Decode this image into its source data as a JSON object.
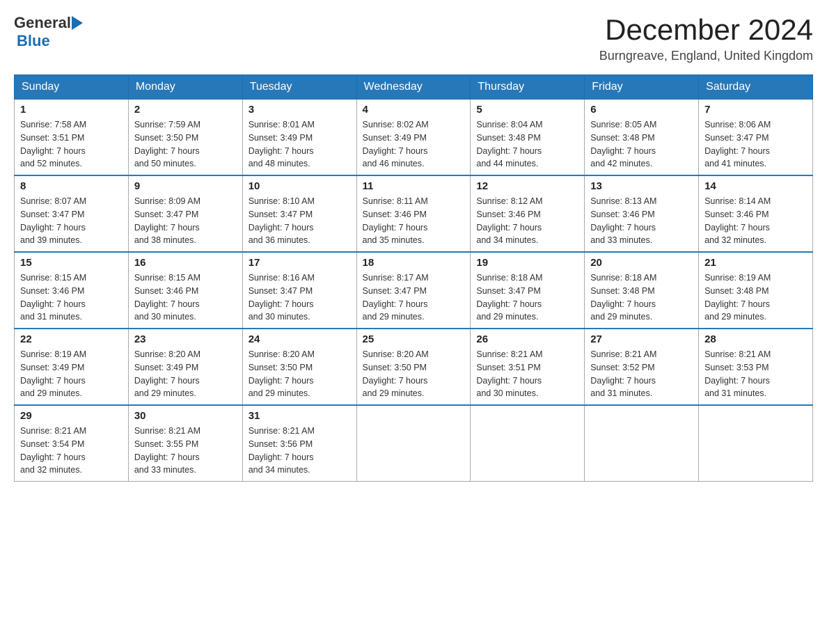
{
  "header": {
    "month_year": "December 2024",
    "location": "Burngreave, England, United Kingdom"
  },
  "logo": {
    "general": "General",
    "blue": "Blue"
  },
  "days_of_week": [
    "Sunday",
    "Monday",
    "Tuesday",
    "Wednesday",
    "Thursday",
    "Friday",
    "Saturday"
  ],
  "weeks": [
    [
      {
        "day": "1",
        "info": "Sunrise: 7:58 AM\nSunset: 3:51 PM\nDaylight: 7 hours\nand 52 minutes."
      },
      {
        "day": "2",
        "info": "Sunrise: 7:59 AM\nSunset: 3:50 PM\nDaylight: 7 hours\nand 50 minutes."
      },
      {
        "day": "3",
        "info": "Sunrise: 8:01 AM\nSunset: 3:49 PM\nDaylight: 7 hours\nand 48 minutes."
      },
      {
        "day": "4",
        "info": "Sunrise: 8:02 AM\nSunset: 3:49 PM\nDaylight: 7 hours\nand 46 minutes."
      },
      {
        "day": "5",
        "info": "Sunrise: 8:04 AM\nSunset: 3:48 PM\nDaylight: 7 hours\nand 44 minutes."
      },
      {
        "day": "6",
        "info": "Sunrise: 8:05 AM\nSunset: 3:48 PM\nDaylight: 7 hours\nand 42 minutes."
      },
      {
        "day": "7",
        "info": "Sunrise: 8:06 AM\nSunset: 3:47 PM\nDaylight: 7 hours\nand 41 minutes."
      }
    ],
    [
      {
        "day": "8",
        "info": "Sunrise: 8:07 AM\nSunset: 3:47 PM\nDaylight: 7 hours\nand 39 minutes."
      },
      {
        "day": "9",
        "info": "Sunrise: 8:09 AM\nSunset: 3:47 PM\nDaylight: 7 hours\nand 38 minutes."
      },
      {
        "day": "10",
        "info": "Sunrise: 8:10 AM\nSunset: 3:47 PM\nDaylight: 7 hours\nand 36 minutes."
      },
      {
        "day": "11",
        "info": "Sunrise: 8:11 AM\nSunset: 3:46 PM\nDaylight: 7 hours\nand 35 minutes."
      },
      {
        "day": "12",
        "info": "Sunrise: 8:12 AM\nSunset: 3:46 PM\nDaylight: 7 hours\nand 34 minutes."
      },
      {
        "day": "13",
        "info": "Sunrise: 8:13 AM\nSunset: 3:46 PM\nDaylight: 7 hours\nand 33 minutes."
      },
      {
        "day": "14",
        "info": "Sunrise: 8:14 AM\nSunset: 3:46 PM\nDaylight: 7 hours\nand 32 minutes."
      }
    ],
    [
      {
        "day": "15",
        "info": "Sunrise: 8:15 AM\nSunset: 3:46 PM\nDaylight: 7 hours\nand 31 minutes."
      },
      {
        "day": "16",
        "info": "Sunrise: 8:15 AM\nSunset: 3:46 PM\nDaylight: 7 hours\nand 30 minutes."
      },
      {
        "day": "17",
        "info": "Sunrise: 8:16 AM\nSunset: 3:47 PM\nDaylight: 7 hours\nand 30 minutes."
      },
      {
        "day": "18",
        "info": "Sunrise: 8:17 AM\nSunset: 3:47 PM\nDaylight: 7 hours\nand 29 minutes."
      },
      {
        "day": "19",
        "info": "Sunrise: 8:18 AM\nSunset: 3:47 PM\nDaylight: 7 hours\nand 29 minutes."
      },
      {
        "day": "20",
        "info": "Sunrise: 8:18 AM\nSunset: 3:48 PM\nDaylight: 7 hours\nand 29 minutes."
      },
      {
        "day": "21",
        "info": "Sunrise: 8:19 AM\nSunset: 3:48 PM\nDaylight: 7 hours\nand 29 minutes."
      }
    ],
    [
      {
        "day": "22",
        "info": "Sunrise: 8:19 AM\nSunset: 3:49 PM\nDaylight: 7 hours\nand 29 minutes."
      },
      {
        "day": "23",
        "info": "Sunrise: 8:20 AM\nSunset: 3:49 PM\nDaylight: 7 hours\nand 29 minutes."
      },
      {
        "day": "24",
        "info": "Sunrise: 8:20 AM\nSunset: 3:50 PM\nDaylight: 7 hours\nand 29 minutes."
      },
      {
        "day": "25",
        "info": "Sunrise: 8:20 AM\nSunset: 3:50 PM\nDaylight: 7 hours\nand 29 minutes."
      },
      {
        "day": "26",
        "info": "Sunrise: 8:21 AM\nSunset: 3:51 PM\nDaylight: 7 hours\nand 30 minutes."
      },
      {
        "day": "27",
        "info": "Sunrise: 8:21 AM\nSunset: 3:52 PM\nDaylight: 7 hours\nand 31 minutes."
      },
      {
        "day": "28",
        "info": "Sunrise: 8:21 AM\nSunset: 3:53 PM\nDaylight: 7 hours\nand 31 minutes."
      }
    ],
    [
      {
        "day": "29",
        "info": "Sunrise: 8:21 AM\nSunset: 3:54 PM\nDaylight: 7 hours\nand 32 minutes."
      },
      {
        "day": "30",
        "info": "Sunrise: 8:21 AM\nSunset: 3:55 PM\nDaylight: 7 hours\nand 33 minutes."
      },
      {
        "day": "31",
        "info": "Sunrise: 8:21 AM\nSunset: 3:56 PM\nDaylight: 7 hours\nand 34 minutes."
      },
      {
        "day": "",
        "info": ""
      },
      {
        "day": "",
        "info": ""
      },
      {
        "day": "",
        "info": ""
      },
      {
        "day": "",
        "info": ""
      }
    ]
  ]
}
